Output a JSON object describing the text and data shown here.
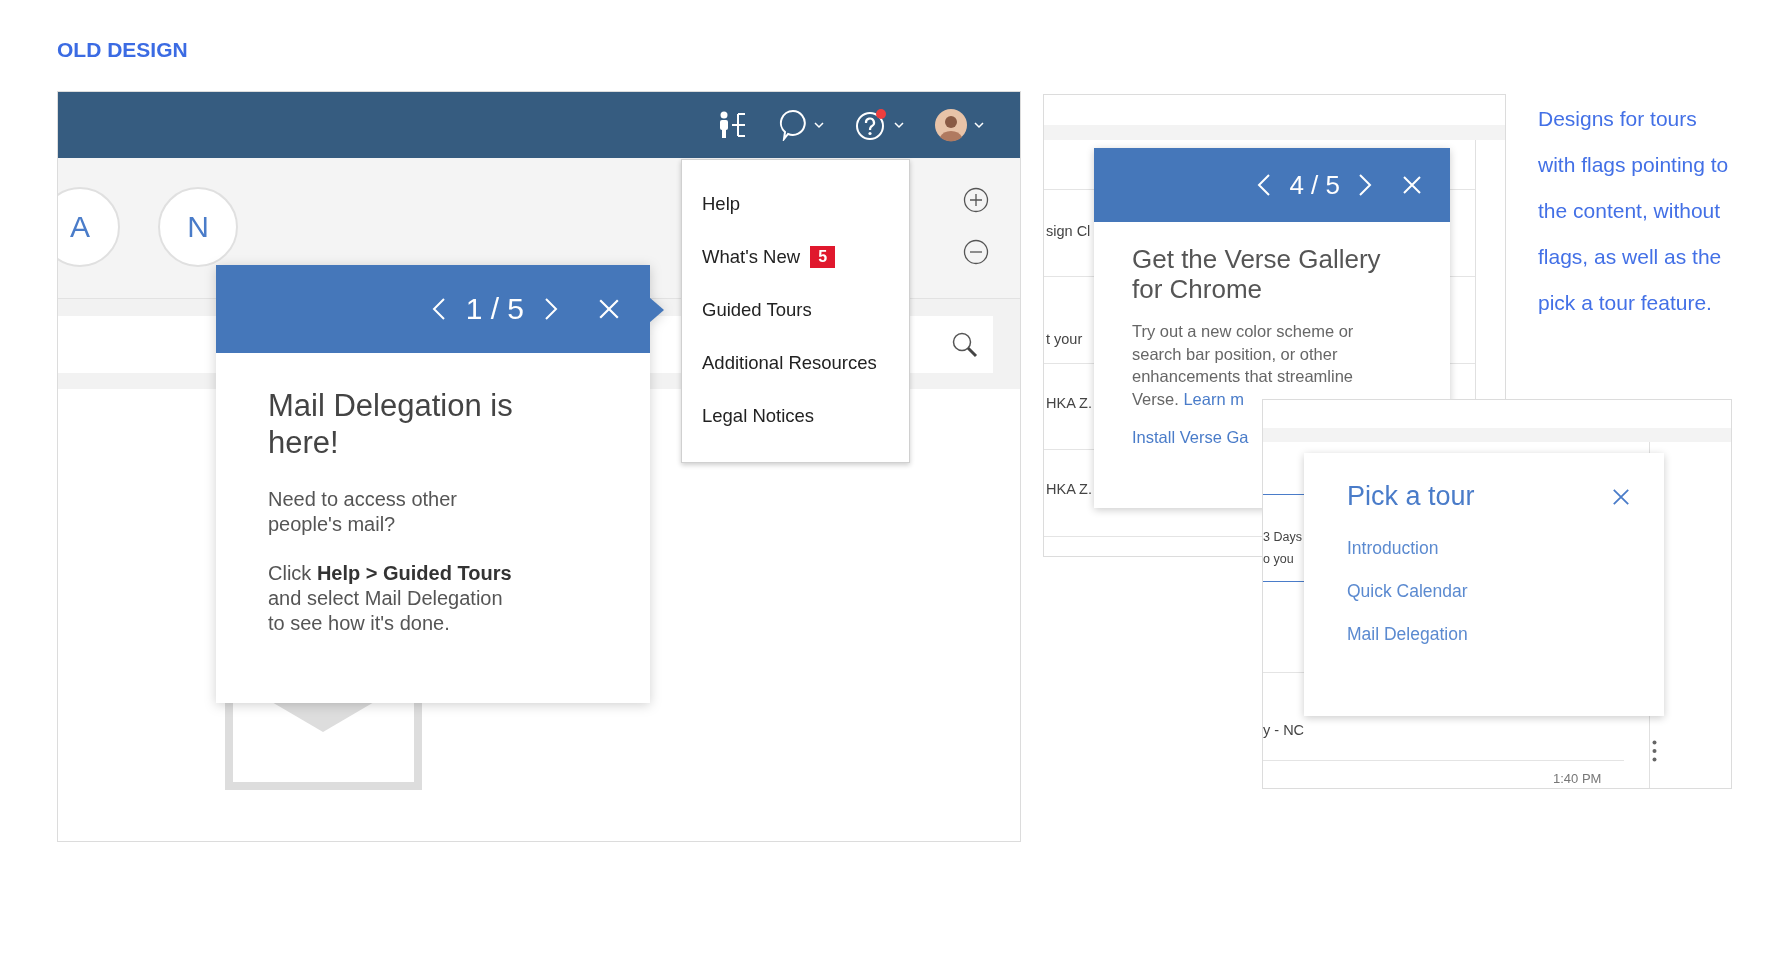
{
  "heading": "OLD DESIGN",
  "left_screen": {
    "avatars": [
      {
        "initial": "A"
      },
      {
        "initial": "N"
      }
    ],
    "help_menu": {
      "items": [
        {
          "label": "Help"
        },
        {
          "label": "What's New",
          "badge": "5"
        },
        {
          "label": "Guided Tours"
        },
        {
          "label": "Additional Resources"
        },
        {
          "label": "Legal Notices"
        }
      ]
    },
    "tour_flag": {
      "step": "1 / 5",
      "title": "Mail Delegation is here!",
      "paragraphs": [
        "Need to access other people's mail?",
        "Click **Help > Guided Tours** and select Mail Delegation to see how it's done."
      ]
    }
  },
  "middle_screen": {
    "list_rows": [
      "sign Cl",
      "t your",
      "HKA Z.",
      "HKA Z."
    ],
    "tour_card": {
      "step": "4 / 5",
      "title": "Get the Verse Gallery for Chrome",
      "body": "Try out a new color scheme or search bar position, or other enhancements that streamline Verse.",
      "link": "Learn m",
      "action": "Install Verse Ga"
    }
  },
  "right_screen": {
    "background_texts": [
      "3 Days",
      "o you",
      "y - NC",
      "1:40 PM"
    ],
    "pick_a_tour": {
      "title": "Pick a tour",
      "tours": [
        "Introduction",
        "Quick Calendar",
        "Mail Delegation"
      ]
    }
  },
  "description_lines": [
    "Designs for tours",
    "with flags pointing to",
    "the content, without",
    "flags, as well as the",
    "pick a tour feature."
  ]
}
